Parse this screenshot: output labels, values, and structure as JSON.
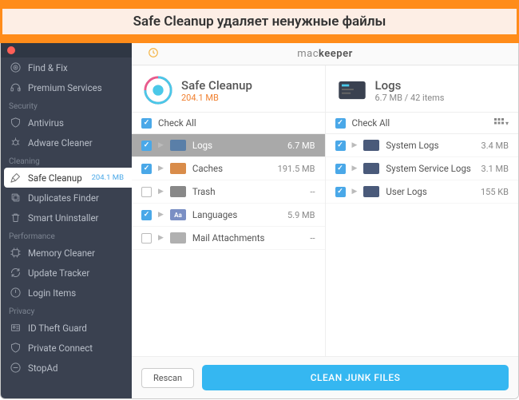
{
  "banner": {
    "text": "Safe Cleanup удаляет ненужные файлы"
  },
  "brand": {
    "light": "mac",
    "bold": "keeper"
  },
  "sidebar": {
    "top": [
      {
        "label": "Find & Fix",
        "icon": "target"
      },
      {
        "label": "Premium Services",
        "icon": "headset"
      }
    ],
    "sections": [
      {
        "title": "Security",
        "items": [
          {
            "label": "Antivirus",
            "icon": "shield-virus"
          },
          {
            "label": "Adware Cleaner",
            "icon": "bug"
          }
        ]
      },
      {
        "title": "Cleaning",
        "items": [
          {
            "label": "Safe Cleanup",
            "icon": "broom",
            "badge": "204.1 MB",
            "active": true
          },
          {
            "label": "Duplicates Finder",
            "icon": "copy"
          },
          {
            "label": "Smart Uninstaller",
            "icon": "trash"
          }
        ]
      },
      {
        "title": "Performance",
        "items": [
          {
            "label": "Memory Cleaner",
            "icon": "chip"
          },
          {
            "label": "Update Tracker",
            "icon": "refresh"
          },
          {
            "label": "Login Items",
            "icon": "power"
          }
        ]
      },
      {
        "title": "Privacy",
        "items": [
          {
            "label": "ID Theft Guard",
            "icon": "id"
          },
          {
            "label": "Private Connect",
            "icon": "shield"
          },
          {
            "label": "StopAd",
            "icon": "stop"
          }
        ]
      }
    ]
  },
  "left_pane": {
    "title": "Safe Cleanup",
    "subtitle": "204.1 MB",
    "subtitle_color": "#f08030",
    "checkall": "Check All",
    "rows": [
      {
        "label": "Logs",
        "size": "6.7 MB",
        "checked": true,
        "selected": true,
        "icon_bg": "#5a7fa8"
      },
      {
        "label": "Caches",
        "size": "191.5 MB",
        "checked": true,
        "icon_bg": "#d98c4a"
      },
      {
        "label": "Trash",
        "size": "--",
        "checked": false,
        "icon_bg": "#888"
      },
      {
        "label": "Languages",
        "size": "5.9 MB",
        "checked": true,
        "icon_bg": "#7a8fc4",
        "icon_text": "Aa"
      },
      {
        "label": "Mail Attachments",
        "size": "--",
        "checked": false,
        "icon_bg": "#b0b0b0"
      }
    ]
  },
  "right_pane": {
    "title": "Logs",
    "subtitle": "6.7 MB / 42 items",
    "subtitle_color": "#888",
    "checkall": "Check All",
    "rows": [
      {
        "label": "System Logs",
        "size": "3.4 MB",
        "checked": true,
        "icon_bg": "#4a5a7a"
      },
      {
        "label": "System Service Logs",
        "size": "3.1 MB",
        "checked": true,
        "icon_bg": "#4a5a7a"
      },
      {
        "label": "User Logs",
        "size": "155 KB",
        "checked": true,
        "icon_bg": "#4a5a7a"
      }
    ]
  },
  "buttons": {
    "rescan": "Rescan",
    "clean": "CLEAN JUNK FILES"
  }
}
